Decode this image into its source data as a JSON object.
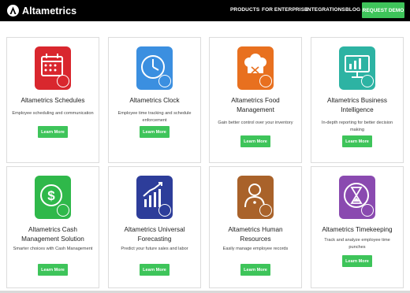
{
  "nav": {
    "brand": "Altametrics",
    "links": [
      "PRODUCTS",
      "FOR ENTERPRISE",
      "INTEGRATIONS",
      "BLOG"
    ],
    "cta": "REQUEST DEMO"
  },
  "cards": [
    {
      "title": "Altametrics Schedules",
      "desc": "Employee scheduling and communication",
      "button": "Learn More",
      "icon": "calendar-icon",
      "color": "#d9272e"
    },
    {
      "title": "Altametrics Clock",
      "desc": "Employee time tracking and schedule enforcement",
      "button": "Learn More",
      "icon": "clock-icon",
      "color": "#3b8fe0"
    },
    {
      "title": "Altametrics Food Management",
      "desc": "Gain better control over your inventory",
      "button": "Learn More",
      "icon": "chef-hat-icon",
      "color": "#e8701f"
    },
    {
      "title": "Altametrics Business Intelligence",
      "desc": "In-depth reporting for better decision making",
      "button": "Learn More",
      "icon": "bar-chart-icon",
      "color": "#2db3a3"
    },
    {
      "title": "Altametrics Cash Management Solution",
      "desc": "Smarter choices with Cash Management",
      "button": "Learn More",
      "icon": "coin-icon",
      "color": "#2fb84a"
    },
    {
      "title": "Altametrics Universal Forecasting",
      "desc": "Predict your future sales and labor",
      "button": "Learn More",
      "icon": "trend-chart-icon",
      "color": "#2d3d9a"
    },
    {
      "title": "Altametrics Human Resources",
      "desc": "Easily manage employee records",
      "button": "Learn More",
      "icon": "person-icon",
      "color": "#a9622a"
    },
    {
      "title": "Altametrics Timekeeping",
      "desc": "Track and analyze employee time punches",
      "button": "Learn More",
      "icon": "hourglass-icon",
      "color": "#8a4ab0"
    }
  ]
}
